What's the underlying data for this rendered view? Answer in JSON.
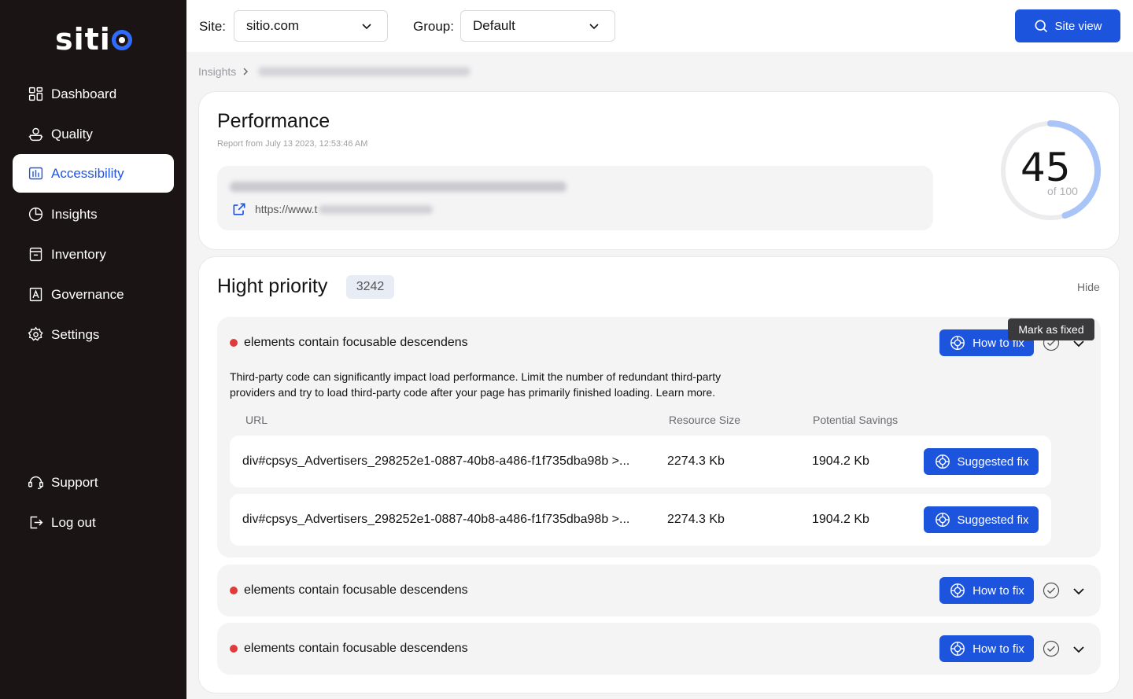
{
  "brand": {
    "logo_text": "siti"
  },
  "sidebar": {
    "items": [
      {
        "label": "Dashboard",
        "icon": "dashboard-icon"
      },
      {
        "label": "Quality",
        "icon": "quality-icon"
      },
      {
        "label": "Accessibility",
        "icon": "accessibility-icon",
        "active": true
      },
      {
        "label": "Insights",
        "icon": "insights-icon"
      },
      {
        "label": "Inventory",
        "icon": "inventory-icon"
      },
      {
        "label": "Governance",
        "icon": "governance-icon"
      },
      {
        "label": "Settings",
        "icon": "gear-icon"
      }
    ],
    "bottom": [
      {
        "label": "Support",
        "icon": "support-icon"
      },
      {
        "label": "Log out",
        "icon": "logout-icon"
      }
    ]
  },
  "topbar": {
    "site_label": "Site:",
    "site_value": "sitio.com",
    "group_label": "Group:",
    "group_value": "Default",
    "site_view_label": "Site view"
  },
  "breadcrumb": {
    "root": "Insights"
  },
  "performance": {
    "title": "Performance",
    "report_date": "Report from July 13 2023, 12:53:46 AM",
    "url_prefix": "https://www.t",
    "score": "45",
    "score_max": "of 100",
    "score_fraction": 0.45
  },
  "high_priority": {
    "title": "Hight priority",
    "count": "3242",
    "hide_label": "Hide",
    "tooltip": "Mark as fixed",
    "issues": [
      {
        "title": "elements contain focusable descendens",
        "how_to_fix": "How to fix"
      },
      {
        "title": "elements contain focusable descendens",
        "how_to_fix": "How to fix"
      },
      {
        "title": "elements contain focusable descendens",
        "how_to_fix": "How to fix"
      }
    ],
    "description": "Third-party code can significantly impact load performance. Limit the number of redundant third-party providers and try to load third-party code after your page has primarily finished loading. Learn more.",
    "table": {
      "headers": {
        "url": "URL",
        "size": "Resource Size",
        "savings": "Potential Savings"
      },
      "rows": [
        {
          "url": "div#cpsys_Advertisers_298252e1-0887-40b8-a486-f1f735dba98b >...",
          "size": "2274.3 Kb",
          "savings": "1904.2 Kb",
          "action": "Suggested fix"
        },
        {
          "url": "div#cpsys_Advertisers_298252e1-0887-40b8-a486-f1f735dba98b >...",
          "size": "2274.3 Kb",
          "savings": "1904.2 Kb",
          "action": "Suggested fix"
        }
      ]
    }
  },
  "colors": {
    "accent": "#1d54de",
    "sidebar_bg": "#1b1414",
    "danger": "#e03b3b",
    "gauge": "#a9c4f7"
  }
}
